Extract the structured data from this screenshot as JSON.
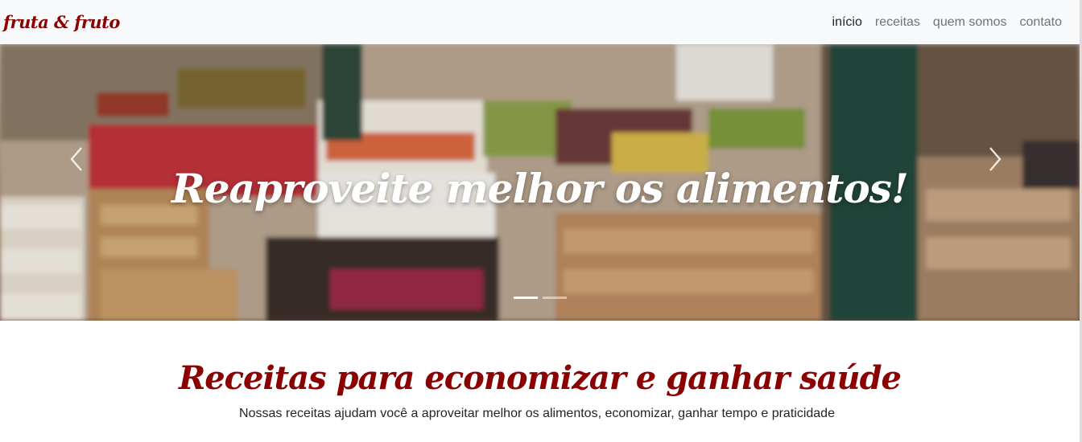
{
  "navbar": {
    "brand": "fruta & fruto",
    "links": [
      {
        "label": "início",
        "active": true
      },
      {
        "label": "receitas",
        "active": false
      },
      {
        "label": "quem somos",
        "active": false
      },
      {
        "label": "contato",
        "active": false
      }
    ]
  },
  "carousel": {
    "caption": "Reaproveite melhor os alimentos!",
    "prev_icon": "chevron-left-icon",
    "next_icon": "chevron-right-icon",
    "slides_count": 2,
    "active_slide": 1
  },
  "section": {
    "title": "Receitas para economizar e ganhar saúde",
    "subtitle": "Nossas receitas ajudam você a aproveitar melhor os alimentos, economizar, ganhar tempo e praticidade"
  },
  "colors": {
    "brand": "#8b0000",
    "navbar_bg": "#f8f9fa",
    "nav_link": "#6c757d",
    "nav_link_active": "#212529"
  }
}
